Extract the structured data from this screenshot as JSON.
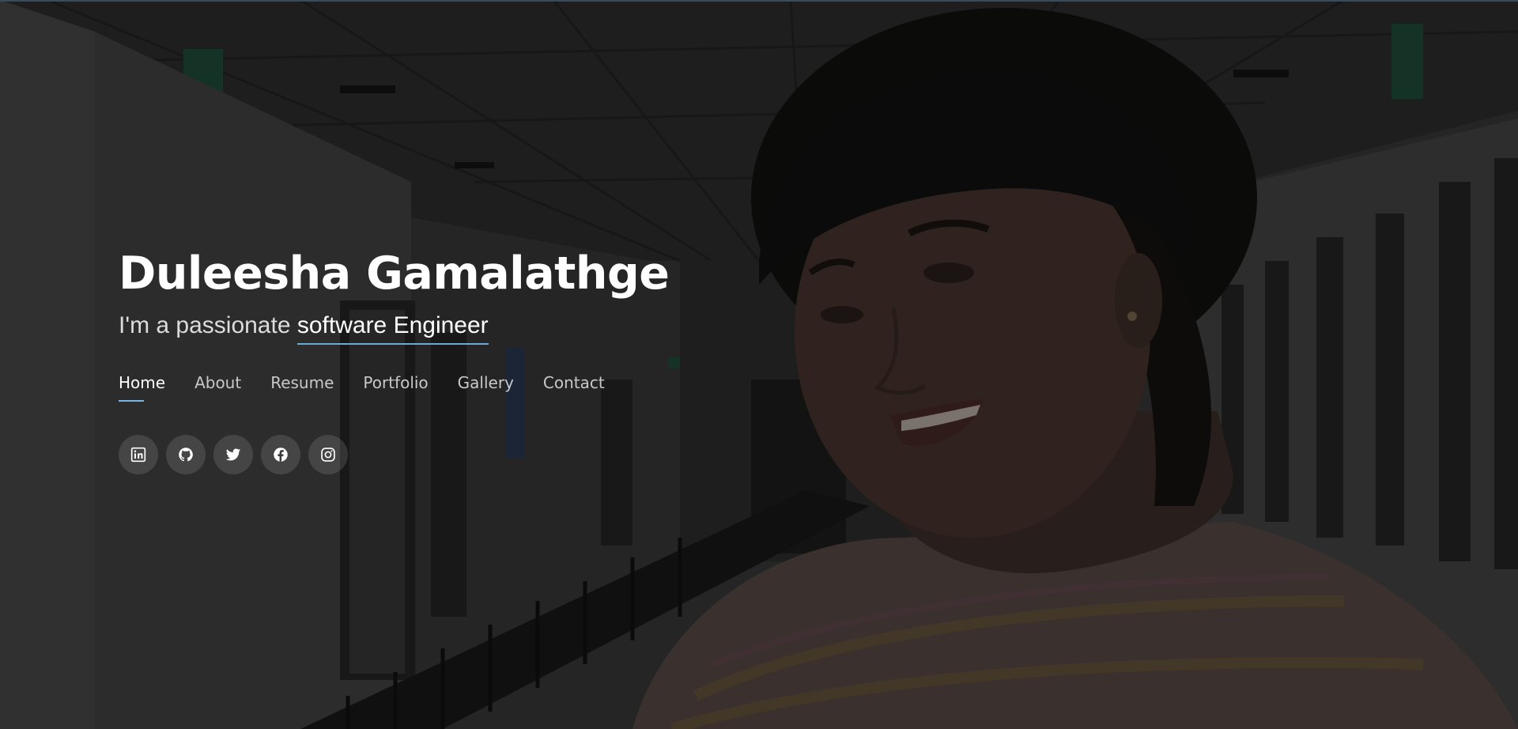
{
  "hero": {
    "name": "Duleesha Gamalathge",
    "tagline_prefix": "I'm a passionate",
    "tagline_typed": "software Engineer"
  },
  "nav": {
    "items": [
      {
        "label": "Home",
        "active": true
      },
      {
        "label": "About",
        "active": false
      },
      {
        "label": "Resume",
        "active": false
      },
      {
        "label": "Portfolio",
        "active": false
      },
      {
        "label": "Gallery",
        "active": false
      },
      {
        "label": "Contact",
        "active": false
      }
    ]
  },
  "socials": [
    {
      "icon": "linkedin-icon"
    },
    {
      "icon": "github-icon"
    },
    {
      "icon": "twitter-icon"
    },
    {
      "icon": "facebook-icon"
    },
    {
      "icon": "instagram-icon"
    }
  ],
  "colors": {
    "accent": "#79b6e6",
    "text": "#ffffff",
    "muted_text": "#c8c8c8"
  }
}
